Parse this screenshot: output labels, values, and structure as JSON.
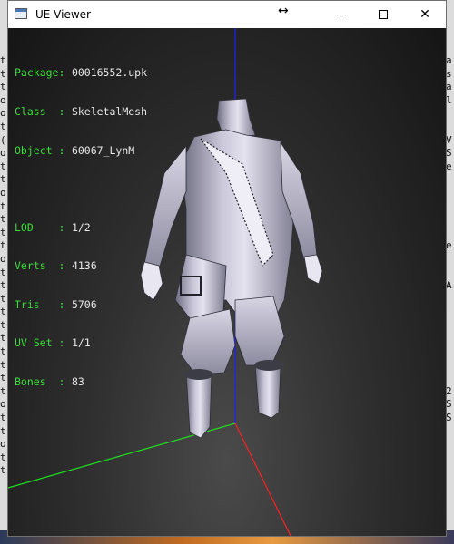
{
  "window": {
    "title": "UE Viewer",
    "move_glyph": "↔",
    "close_glyph": "✕"
  },
  "mesh_info": {
    "package": {
      "label": "Package:",
      "value": "00016552.upk"
    },
    "class": {
      "label": "Class  :",
      "value": "SkeletalMesh"
    },
    "object": {
      "label": "Object :",
      "value": "60067_LynM"
    },
    "lod": {
      "label": "LOD    :",
      "value": "1/2"
    },
    "verts": {
      "label": "Verts  :",
      "value": "4136"
    },
    "tris": {
      "label": "Tris   :",
      "value": "5706"
    },
    "uvset": {
      "label": "UV Set :",
      "value": "1/1"
    },
    "bones": {
      "label": "Bones  :",
      "value": "83"
    }
  },
  "background_console": {
    "left_chars": "t\nt\nt\no\no\nt\n(\no\nt\nt\no\nt\nt\nt\nt\no\nt\nt\nt\nt\nt\nt\nt\nt\nt\nt\no\nt\nt\no\nt\nt",
    "right_chars": "a\ns\na\nl\n \n \nV\nS\ne\n \n \n \n \n \ne\n \n \nA\n \n \n \n \n \n \n \n2\nS\nS"
  },
  "colors": {
    "label_green": "#3adf3a",
    "value_white": "#e8e8e8",
    "axis_x": "#ff2020",
    "axis_y": "#20e020",
    "axis_z": "#2020ff"
  }
}
